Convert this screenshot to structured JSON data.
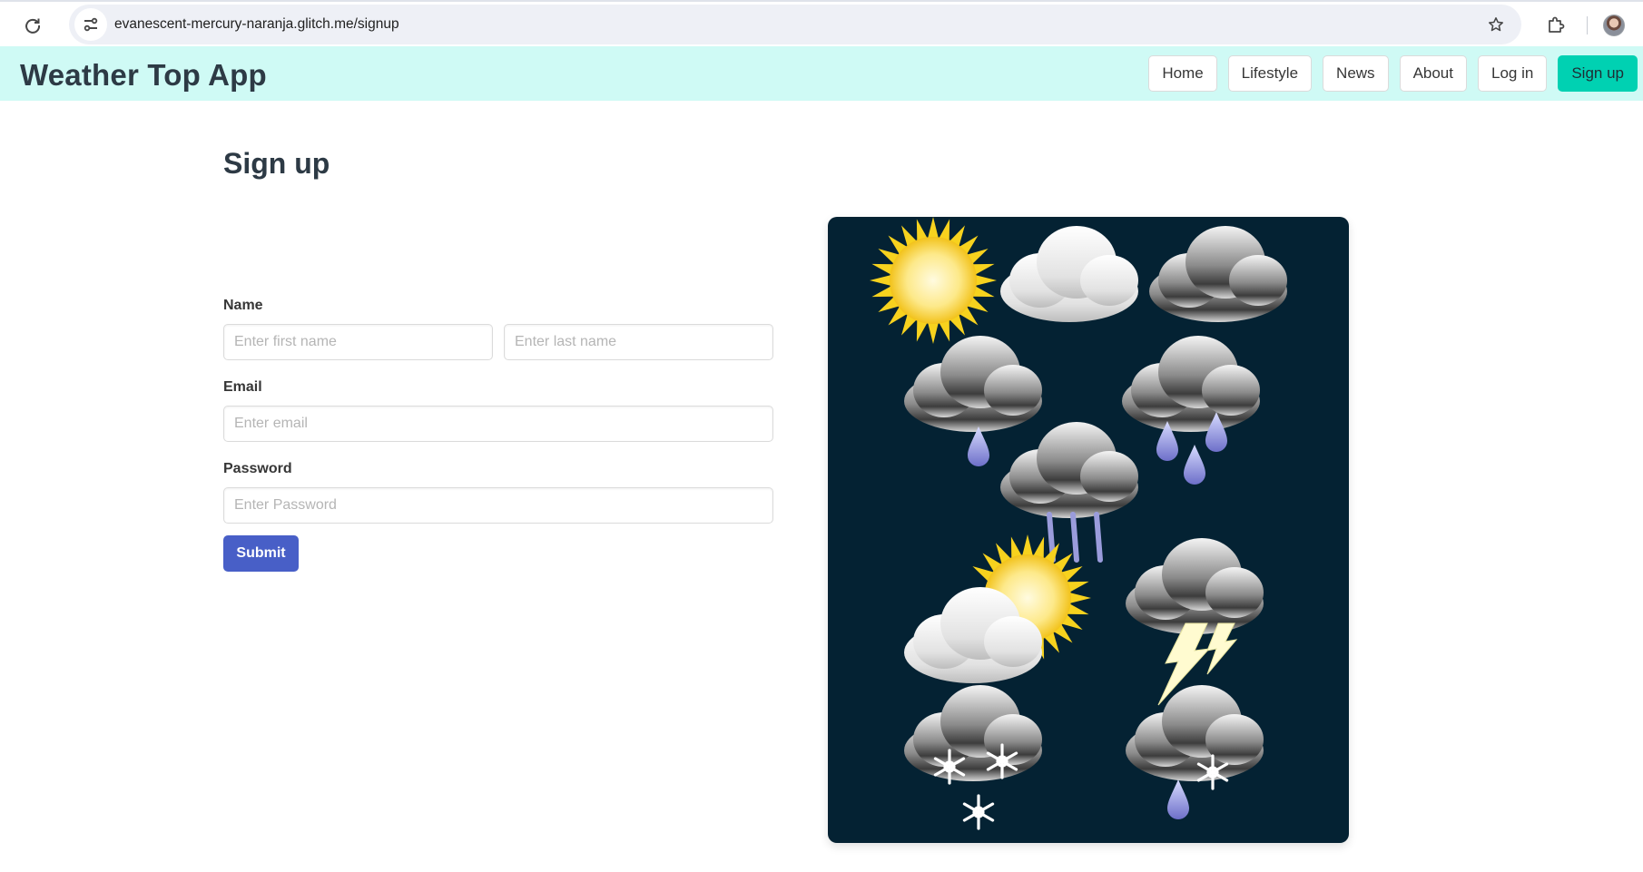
{
  "browser": {
    "url": "evanescent-mercury-naranja.glitch.me/signup"
  },
  "navbar": {
    "brand": "Weather Top App",
    "items": [
      {
        "label": "Home"
      },
      {
        "label": "Lifestyle"
      },
      {
        "label": "News"
      },
      {
        "label": "About"
      },
      {
        "label": "Log in"
      },
      {
        "label": "Sign up"
      }
    ]
  },
  "signup": {
    "title": "Sign up",
    "name_label": "Name",
    "first_name_placeholder": "Enter first name",
    "last_name_placeholder": "Enter last name",
    "email_label": "Email",
    "email_placeholder": "Enter email",
    "password_label": "Password",
    "password_placeholder": "Enter Password",
    "submit_label": "Submit"
  },
  "image": {
    "icons": [
      "sun-icon",
      "cloud-icon",
      "dark-cloud-icon",
      "light-rain-icon",
      "rain-icon",
      "heavy-rain-icon",
      "partly-sunny-icon",
      "thunderstorm-icon",
      "snow-icon",
      "sleet-icon"
    ]
  },
  "colors": {
    "navbar_bg": "#cffaf5",
    "signup_button": "#00d1b2",
    "submit_button": "#485fc7",
    "image_bg": "#042233"
  }
}
